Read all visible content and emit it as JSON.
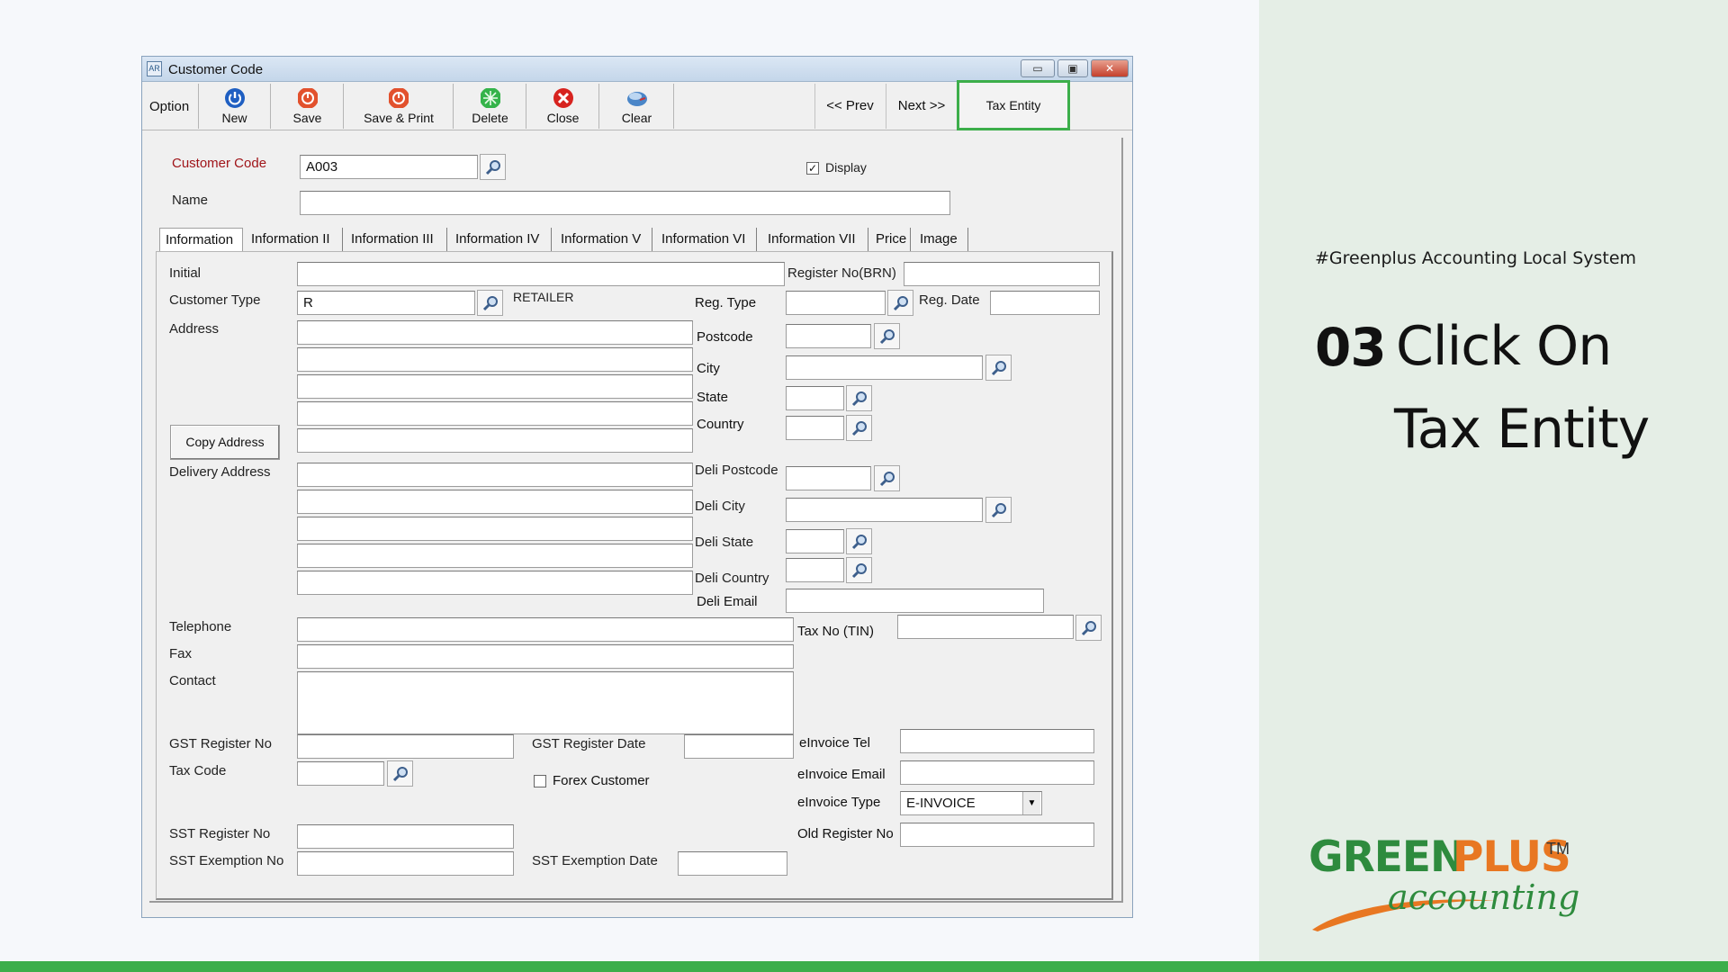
{
  "window": {
    "title": "Customer Code",
    "app_icon_text": "AR",
    "controls": {
      "minimize": "▭",
      "restore": "▣",
      "close": "✕"
    }
  },
  "toolbar": {
    "option_label": "Option",
    "buttons": [
      {
        "label": "New",
        "icon": "power-icon",
        "color": "#1f5fc2"
      },
      {
        "label": "Save",
        "icon": "save-icon",
        "color": "#e2512d"
      },
      {
        "label": "Save & Print",
        "icon": "save-print-icon",
        "color": "#e2512d"
      },
      {
        "label": "Delete",
        "icon": "delete-icon",
        "color": "#35b34a"
      },
      {
        "label": "Close",
        "icon": "close-icon",
        "color": "#d7231f"
      },
      {
        "label": "Clear",
        "icon": "clear-icon",
        "color": "#4a86c8"
      }
    ],
    "prev": "<<  Prev",
    "next": "Next  >>",
    "tax_entity": "Tax Entity"
  },
  "header": {
    "customer_code_label": "Customer Code",
    "customer_code_value": "A003",
    "display_label": "Display",
    "display_checked": true,
    "name_label": "Name",
    "name_value": ""
  },
  "tabs": [
    "Information",
    "Information II",
    "Information III",
    "Information IV",
    "Information V",
    "Information VI",
    "Information VII",
    "Price",
    "Image"
  ],
  "fields": {
    "initial": "Initial",
    "register_no": "Register No(BRN)",
    "customer_type": "Customer Type",
    "customer_type_value": "R",
    "customer_type_desc": "RETAILER",
    "reg_type": "Reg. Type",
    "reg_date": "Reg. Date",
    "address": "Address",
    "postcode": "Postcode",
    "city": "City",
    "state": "State",
    "country": "Country",
    "copy_address": "Copy Address",
    "delivery_address": "Delivery Address",
    "deli_postcode": "Deli Postcode",
    "deli_city": "Deli City",
    "deli_state": "Deli State",
    "deli_country": "Deli Country",
    "deli_email": "Deli Email",
    "telephone": "Telephone",
    "tax_no": "Tax No (TIN)",
    "fax": "Fax",
    "contact": "Contact",
    "gst_register_no": "GST Register No",
    "gst_register_date": "GST Register Date",
    "einvoice_tel": "eInvoice Tel",
    "tax_code": "Tax Code",
    "forex_customer": "Forex Customer",
    "einvoice_email": "eInvoice Email",
    "einvoice_type": "eInvoice Type",
    "einvoice_type_value": "E-INVOICE",
    "sst_register_no": "SST Register No",
    "old_register_no": "Old Register No",
    "sst_exemption_no": "SST Exemption No",
    "sst_exemption_date": "SST Exemption Date"
  },
  "slide": {
    "hashtag": "#Greenplus Accounting Local System",
    "step_number": "03",
    "step_line1": "Click On",
    "step_line2": "Tax Entity",
    "logo_main_1": "GREEN",
    "logo_main_2": "PLUS",
    "logo_tm": "TM",
    "logo_sub": "accounting",
    "brand_green": "#3cae4a",
    "brand_orange": "#e87722"
  }
}
